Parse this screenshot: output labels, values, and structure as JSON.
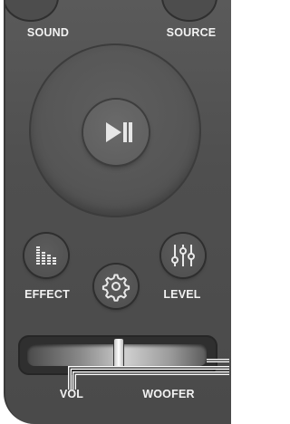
{
  "buttons": {
    "sound": "SOUND",
    "source": "SOURCE",
    "effect": "EFFECT",
    "level": "LEVEL"
  },
  "slider": {
    "vol_label": "VOL",
    "woofer_label": "WOOFER"
  },
  "icons": {
    "play_pause": "play-pause-icon",
    "effect": "equalizer-bars-icon",
    "settings": "gear-icon",
    "level": "vertical-sliders-icon"
  },
  "colors": {
    "body": "#555555",
    "text": "#f2f2f2"
  }
}
